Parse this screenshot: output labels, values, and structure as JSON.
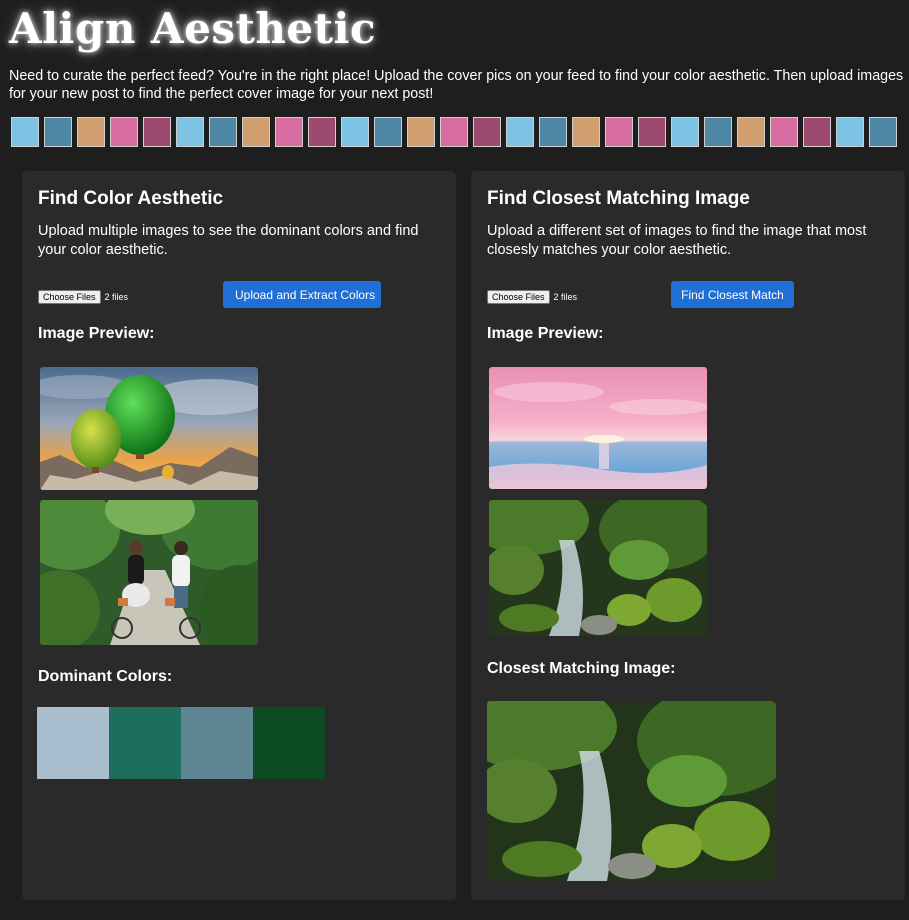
{
  "header": {
    "title": "Align Aesthetic",
    "intro": "Need to curate the perfect feed? You're in the right place! Upload the cover pics on your feed to find your color aesthetic. Then upload images for your new post to find the perfect cover image for your next post!"
  },
  "swatch_strip": {
    "colors": [
      "#7ec2e4",
      "#4e87a4",
      "#d19e70",
      "#d66c9f",
      "#9d4a70"
    ],
    "repeat_count": 27
  },
  "aesthetic_panel": {
    "title": "Find Color Aesthetic",
    "description": "Upload multiple images to see the dominant colors and find your color aesthetic.",
    "file_button_label": "Choose Files",
    "file_count": "2 files",
    "action_label": "Upload and Extract Colors",
    "preview_label": "Image Preview:",
    "preview_images": [
      "hot-air-balloons-over-mountains",
      "couple-on-bicycles-in-jungle"
    ],
    "dominant_label": "Dominant Colors:",
    "dominant_colors": [
      "#a9bfcf",
      "#1d6e5c",
      "#5e8592",
      "#0b4c22"
    ]
  },
  "match_panel": {
    "title": "Find Closest Matching Image",
    "description": "Upload a different set of images to find the image that most closesly matches your color aesthetic.",
    "file_button_label": "Choose Files",
    "file_count": "2 files",
    "action_label": "Find Closest Match",
    "preview_label": "Image Preview:",
    "preview_images": [
      "pink-ocean-sunset",
      "mossy-forest-stream"
    ],
    "result_label": "Closest Matching Image:",
    "result_image": "mossy-forest-stream"
  },
  "colors": {
    "page_background": "#1e1e1e",
    "panel_background": "#2a2a2b",
    "button_blue": "#1f6fd6"
  }
}
